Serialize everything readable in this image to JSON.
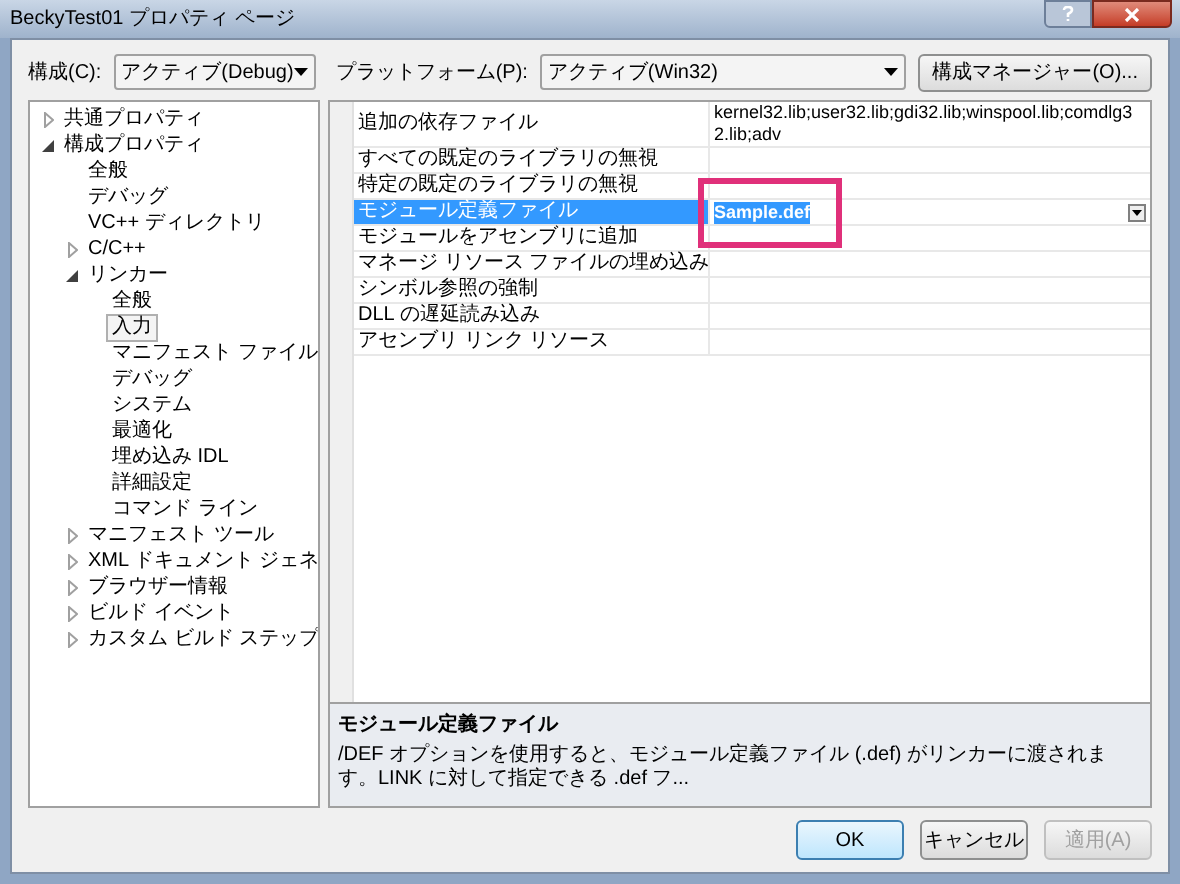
{
  "window": {
    "title": "BeckyTest01 プロパティ ページ"
  },
  "toolbar": {
    "config_label": "構成(C):",
    "config_value": "アクティブ(Debug)",
    "platform_label": "プラットフォーム(P):",
    "platform_value": "アクティブ(Win32)",
    "manager_button": "構成マネージャー(O)..."
  },
  "tree": [
    {
      "label": "共通プロパティ",
      "expanded": false,
      "selected": false
    },
    {
      "label": "構成プロパティ",
      "expanded": true,
      "selected": false,
      "children": [
        {
          "label": "全般",
          "selected": false
        },
        {
          "label": "デバッグ",
          "selected": false
        },
        {
          "label": "VC++ ディレクトリ",
          "selected": false
        },
        {
          "label": "C/C++",
          "expanded": false,
          "selected": false
        },
        {
          "label": "リンカー",
          "expanded": true,
          "selected": false,
          "children": [
            {
              "label": "全般",
              "selected": false
            },
            {
              "label": "入力",
              "selected": true
            },
            {
              "label": "マニフェスト ファイル",
              "selected": false
            },
            {
              "label": "デバッグ",
              "selected": false
            },
            {
              "label": "システム",
              "selected": false
            },
            {
              "label": "最適化",
              "selected": false
            },
            {
              "label": "埋め込み IDL",
              "selected": false
            },
            {
              "label": "詳細設定",
              "selected": false
            },
            {
              "label": "コマンド ライン",
              "selected": false
            }
          ]
        },
        {
          "label": "マニフェスト ツール",
          "expanded": false,
          "selected": false
        },
        {
          "label": "XML ドキュメント ジェネ",
          "expanded": false,
          "selected": false
        },
        {
          "label": "ブラウザー情報",
          "expanded": false,
          "selected": false
        },
        {
          "label": "ビルド イベント",
          "expanded": false,
          "selected": false
        },
        {
          "label": "カスタム ビルド ステップ",
          "expanded": false,
          "selected": false
        }
      ]
    }
  ],
  "properties": [
    {
      "name": "追加の依存ファイル",
      "value": "kernel32.lib;user32.lib;gdi32.lib;winspool.lib;comdlg32.lib;adv",
      "selected": false,
      "annotated": false
    },
    {
      "name": "すべての既定のライブラリの無視",
      "selected": false,
      "annotated": false
    },
    {
      "name": "特定の既定のライブラリの無視",
      "selected": false,
      "annotated": false
    },
    {
      "name": "モジュール定義ファイル",
      "value": "Sample.def",
      "selected": true,
      "annotated": true
    },
    {
      "name": "モジュールをアセンブリに追加",
      "selected": false,
      "annotated": false
    },
    {
      "name": "マネージ リソース ファイルの埋め込み",
      "selected": false,
      "annotated": false
    },
    {
      "name": "シンボル参照の強制",
      "selected": false,
      "annotated": false
    },
    {
      "name": "DLL の遅延読み込み",
      "selected": false,
      "annotated": false
    },
    {
      "name": "アセンブリ リンク リソース",
      "selected": false,
      "annotated": false
    }
  ],
  "description": {
    "title": "モジュール定義ファイル",
    "text": "/DEF オプションを使用すると、モジュール定義ファイル (.def) がリンカーに渡されます。LINK に対して指定できる .def フ..."
  },
  "buttons": [
    {
      "label": "OK",
      "disabled": false,
      "default": true
    },
    {
      "label": "キャンセル",
      "disabled": false,
      "default": false
    },
    {
      "label": "適用(A)",
      "disabled": true,
      "default": false
    }
  ]
}
